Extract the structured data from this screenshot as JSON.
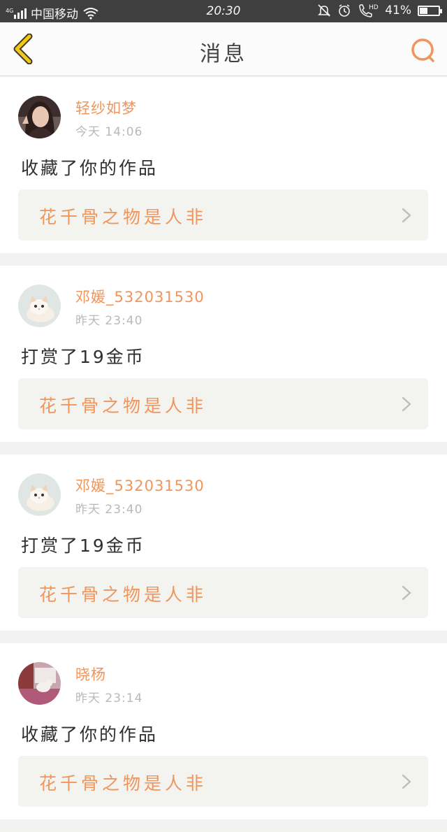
{
  "status_bar": {
    "carrier": "中国移动",
    "network": "4G",
    "time": "20:30",
    "hd_label": "HD",
    "battery_text": "41%",
    "battery_level": 0.41
  },
  "nav": {
    "title": "消息"
  },
  "messages": [
    {
      "username": "轻纱如梦",
      "time": "今天 14:06",
      "action": "收藏了你的作品",
      "work_title": "花千骨之物是人非"
    },
    {
      "username": "邓媛_532031530",
      "time": "昨天 23:40",
      "action": "打赏了19金币",
      "work_title": "花千骨之物是人非"
    },
    {
      "username": "邓媛_532031530",
      "time": "昨天 23:40",
      "action": "打赏了19金币",
      "work_title": "花千骨之物是人非"
    },
    {
      "username": "晓杨",
      "time": "昨天 23:14",
      "action": "收藏了你的作品",
      "work_title": "花千骨之物是人非"
    }
  ],
  "colors": {
    "accent": "#f0955b",
    "back_arrow": "#f5c518",
    "status_bar_bg": "#3f3f3f"
  }
}
